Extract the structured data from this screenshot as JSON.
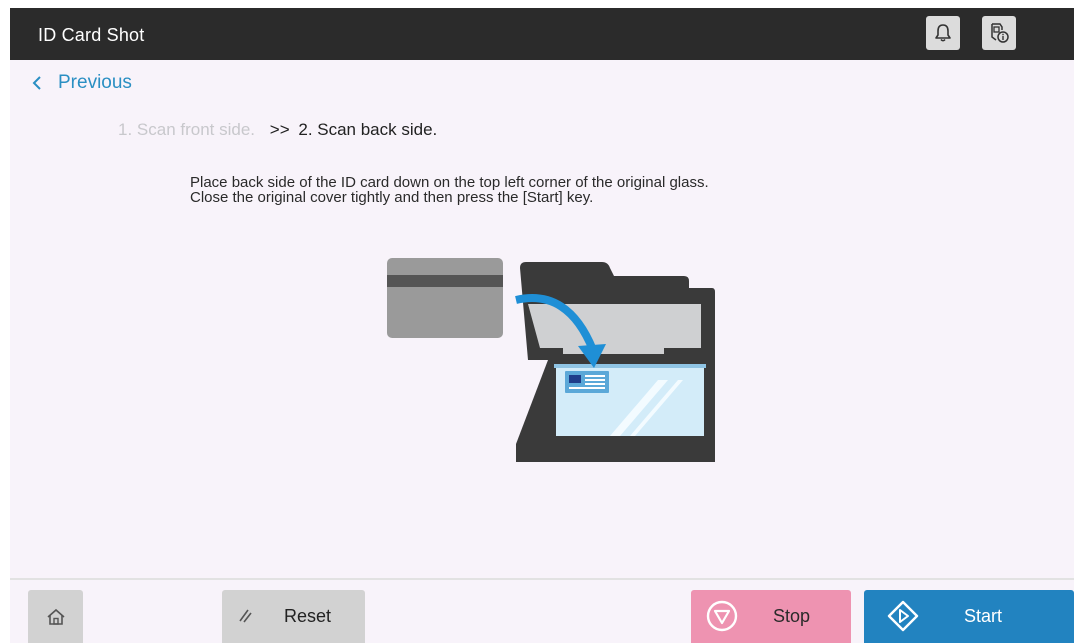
{
  "header": {
    "title": "ID Card Shot",
    "bell_icon": "bell-icon",
    "job_info_icon": "job-info-icon"
  },
  "nav": {
    "previous_label": "Previous"
  },
  "steps": {
    "step1": "1. Scan front side.",
    "separator": ">>",
    "step2": "2. Scan back side."
  },
  "instructions": {
    "line1": "Place back side of the ID card down on the top left corner of the original glass.",
    "line2": "Close the original cover tightly and then press the [Start] key."
  },
  "bottom": {
    "home_icon": "home-icon",
    "reset_label": "Reset",
    "stop_label": "Stop",
    "start_label": "Start"
  },
  "colors": {
    "accent": "#2a8fc3",
    "header_bg": "#2b2b2b",
    "content_bg": "#f8f3fa",
    "stop_bg": "#ee93b1",
    "start_bg": "#2283c0"
  }
}
